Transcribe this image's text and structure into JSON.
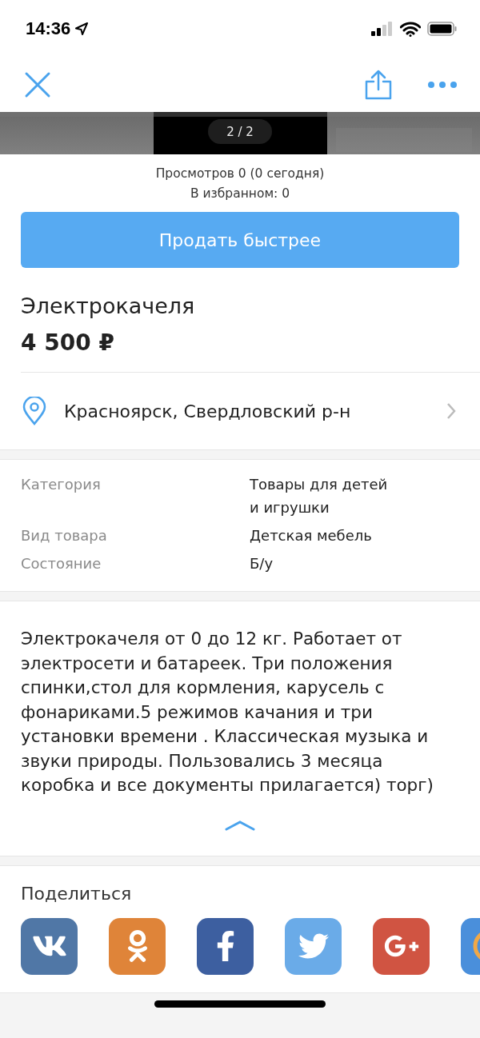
{
  "status_bar": {
    "time": "14:36"
  },
  "gallery": {
    "counter": "2 / 2"
  },
  "stats": [
    "Просмотров 0 (0 сегодня)",
    "В избранном: 0"
  ],
  "promote_button": "Продать быстрее",
  "title": "Электрокачеля",
  "price": "4 500 ₽",
  "location": "Красноярск, Свердловский р-н",
  "params": [
    {
      "label": "Категория",
      "value": "Товары для детей\nи игрушки"
    },
    {
      "label": "Вид товара",
      "value": "Детская мебель"
    },
    {
      "label": "Состояние",
      "value": "Б/у"
    }
  ],
  "description": "Электрокачеля от 0 до 12 кг. Работает от электросети и батареек. Три положения спинки,стол для кормления, карусель с фонариками.5 режимов качания и три установки времени . Классическая музыка и звуки природы. Пользовались 3 месяца коробка и все документы прилагается) торг)",
  "description_expanded": true,
  "share": {
    "title": "Поделиться",
    "services": [
      {
        "kind": "vk",
        "color": "#5077a6"
      },
      {
        "kind": "ok",
        "color": "#df8439"
      },
      {
        "kind": "facebook",
        "color": "#3d5fa0"
      },
      {
        "kind": "twitter",
        "color": "#6aabe8"
      },
      {
        "kind": "googleplus",
        "color": "#d05442"
      },
      {
        "kind": "rings",
        "color": "#4a8fdb"
      }
    ]
  }
}
